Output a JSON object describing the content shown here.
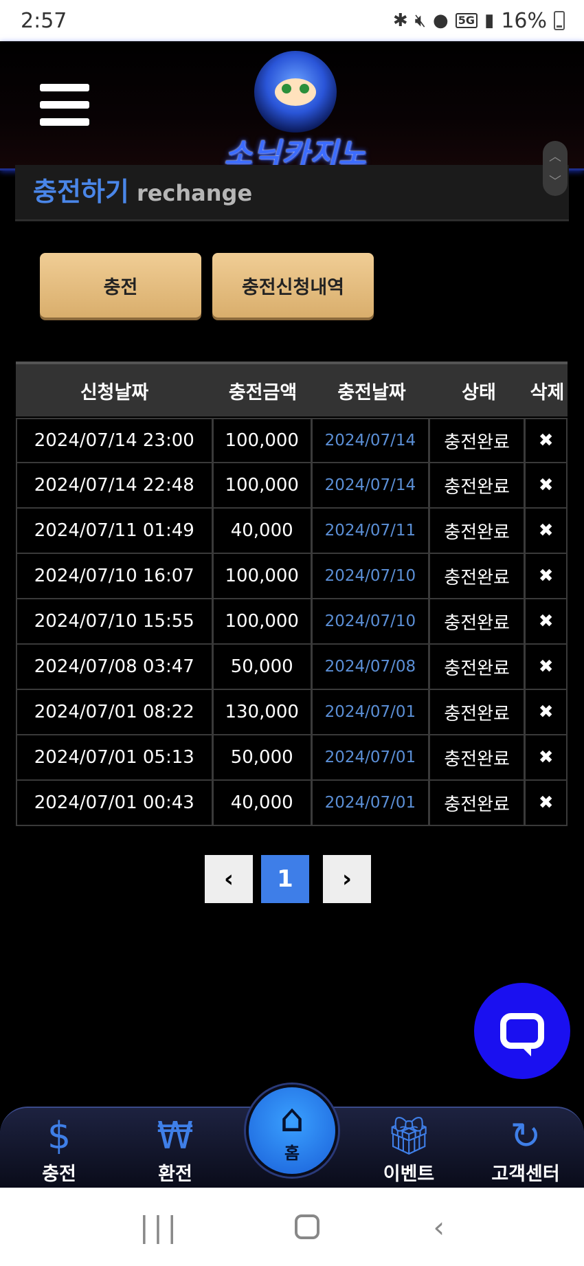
{
  "status_bar": {
    "time": "2:57",
    "battery": "16%",
    "network": "5G",
    "icons": [
      "bluetooth-icon",
      "mute-icon",
      "location-icon",
      "signal-icon",
      "battery-icon"
    ]
  },
  "header": {
    "logo_text": "소닉카지노"
  },
  "page_title": {
    "ko": "충전하기",
    "en": "rechange"
  },
  "actions": {
    "charge_label": "충전",
    "history_label": "충전신청내역"
  },
  "table": {
    "headers": [
      "신청날짜",
      "충전금액",
      "충전날짜",
      "상태",
      "삭제"
    ],
    "rows": [
      {
        "request_date": "2024/07/14 23:00",
        "amount": "100,000",
        "charge_date": "2024/07/14",
        "status": "충전완료",
        "delete": "✖"
      },
      {
        "request_date": "2024/07/14 22:48",
        "amount": "100,000",
        "charge_date": "2024/07/14",
        "status": "충전완료",
        "delete": "✖"
      },
      {
        "request_date": "2024/07/11 01:49",
        "amount": "40,000",
        "charge_date": "2024/07/11",
        "status": "충전완료",
        "delete": "✖"
      },
      {
        "request_date": "2024/07/10 16:07",
        "amount": "100,000",
        "charge_date": "2024/07/10",
        "status": "충전완료",
        "delete": "✖"
      },
      {
        "request_date": "2024/07/10 15:55",
        "amount": "100,000",
        "charge_date": "2024/07/10",
        "status": "충전완료",
        "delete": "✖"
      },
      {
        "request_date": "2024/07/08 03:47",
        "amount": "50,000",
        "charge_date": "2024/07/08",
        "status": "충전완료",
        "delete": "✖"
      },
      {
        "request_date": "2024/07/01 08:22",
        "amount": "130,000",
        "charge_date": "2024/07/01",
        "status": "충전완료",
        "delete": "✖"
      },
      {
        "request_date": "2024/07/01 05:13",
        "amount": "50,000",
        "charge_date": "2024/07/01",
        "status": "충전완료",
        "delete": "✖"
      },
      {
        "request_date": "2024/07/01 00:43",
        "amount": "40,000",
        "charge_date": "2024/07/01",
        "status": "충전완료",
        "delete": "✖"
      }
    ]
  },
  "pagination": {
    "prev": "‹",
    "current": "1",
    "next": "›"
  },
  "bottom_nav": {
    "charge": "충전",
    "exchange": "환전",
    "home": "홈",
    "event": "이벤트",
    "support": "고객센터"
  },
  "colors": {
    "accent_blue": "#4a86e8",
    "button_gold": "#e4bc80",
    "chat_blue": "#1a10f0"
  }
}
